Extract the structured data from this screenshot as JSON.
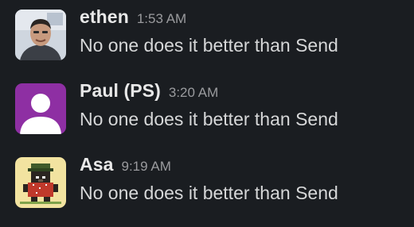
{
  "messages": [
    {
      "author": "ethen",
      "time": "1:53 AM",
      "text": "No one does it better than Send",
      "avatar": "photo-avatar"
    },
    {
      "author": "Paul (PS)",
      "time": "3:20 AM",
      "text": "No one does it better than Send",
      "avatar": "default-user-avatar",
      "avatar_color": "#8e2fa3"
    },
    {
      "author": "Asa",
      "time": "9:19 AM",
      "text": "No one does it better than Send",
      "avatar": "pixel-bear-avatar",
      "avatar_color": "#f2e3a0"
    }
  ],
  "colors": {
    "background": "#1a1d21",
    "name": "#e8e8e8",
    "timestamp": "#9a9b9e",
    "text": "#d6d7d8"
  }
}
